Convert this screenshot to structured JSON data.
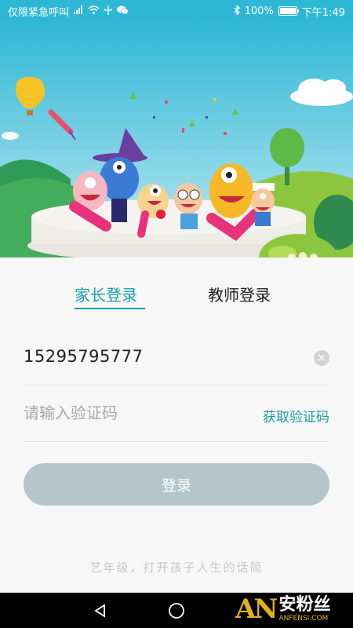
{
  "status_bar": {
    "left_text": "仅限紧急呼叫",
    "battery_percent": "100%",
    "battery_level": 1.0,
    "time": "下午1:49",
    "icons": [
      "signal-icon",
      "wifi-icon",
      "usb-icon",
      "wechat-icon",
      "bluetooth-icon",
      "battery-icon"
    ]
  },
  "hero": {
    "sky_color": "#2fb8d6",
    "decor": [
      "hot-air-balloon",
      "rocket",
      "cartoon-characters",
      "stage",
      "trees",
      "clouds"
    ]
  },
  "tabs": {
    "parent_label": "家长登录",
    "teacher_label": "教师登录",
    "active": "parent"
  },
  "form": {
    "phone_value": "15295795777",
    "code_placeholder": "请输入验证码",
    "get_code_label": "获取验证码",
    "login_label": "登录"
  },
  "slogan": "艺年级，打开孩子人生的话简",
  "nav": {
    "icons": [
      "back-icon",
      "home-icon",
      "recents-icon"
    ]
  },
  "watermark": {
    "logo": "AN",
    "cn": "安粉丝",
    "en": "ANFENSI.COM"
  },
  "colors": {
    "accent": "#1aa0ad",
    "sky": "#2fb8d6",
    "button": "#b4c6c9"
  }
}
